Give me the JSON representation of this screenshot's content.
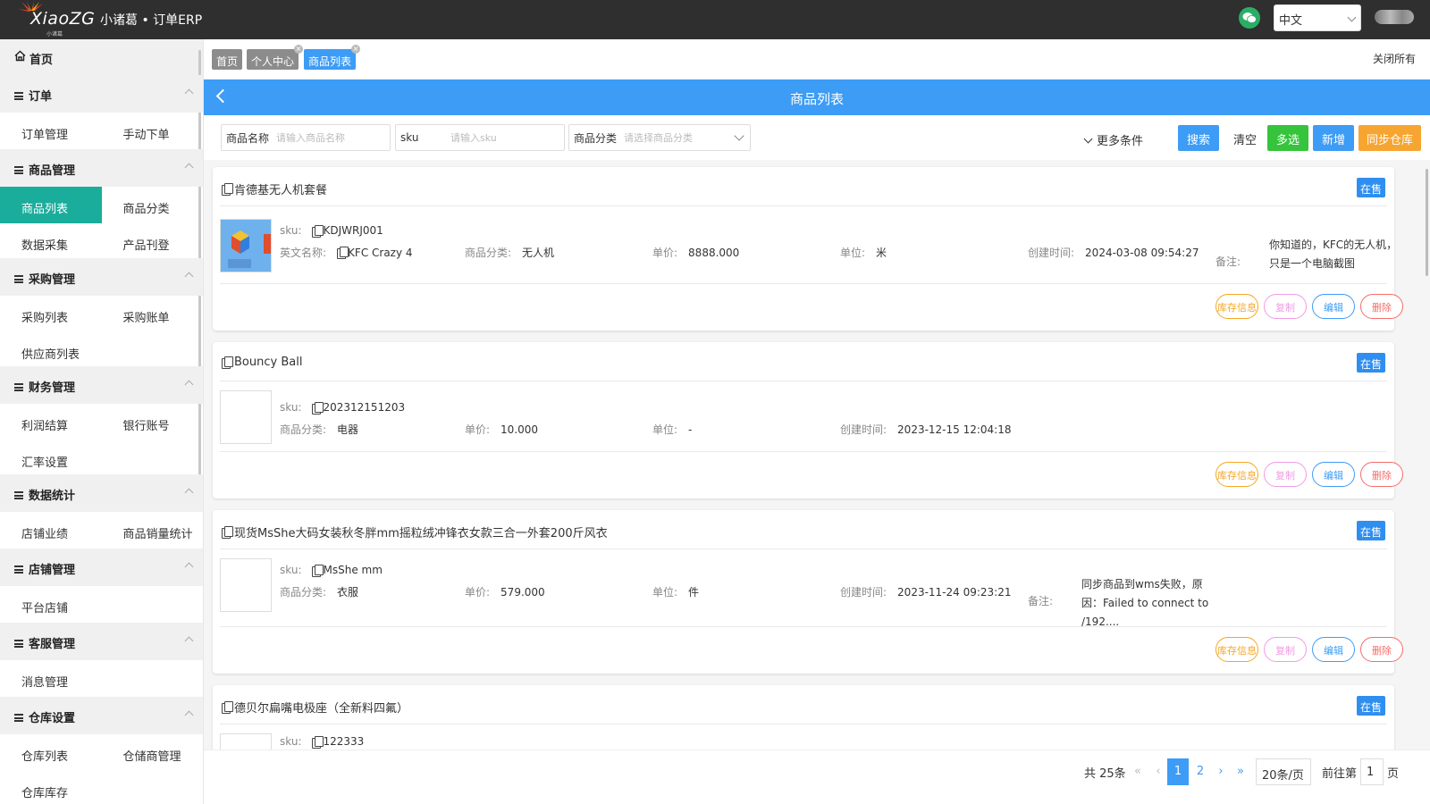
{
  "app": {
    "logo_text": "XiaoZG",
    "logo_sub": "小诸葛",
    "title": "小诸葛 • 订单ERP"
  },
  "topbar": {
    "language": "中文"
  },
  "sidebar": {
    "home": "首页",
    "groups": [
      {
        "label": "订单",
        "items": [
          "订单管理",
          "手动下单"
        ]
      },
      {
        "label": "商品管理",
        "items": [
          "商品列表",
          "商品分类",
          "数据采集",
          "产品刊登"
        ]
      },
      {
        "label": "采购管理",
        "items": [
          "采购列表",
          "采购账单",
          "供应商列表"
        ]
      },
      {
        "label": "财务管理",
        "items": [
          "利润结算",
          "银行账号",
          "汇率设置"
        ]
      },
      {
        "label": "数据统计",
        "items": [
          "店铺业绩",
          "商品销量统计"
        ]
      },
      {
        "label": "店铺管理",
        "items": [
          "平台店铺"
        ]
      },
      {
        "label": "客服管理",
        "items": [
          "消息管理"
        ]
      },
      {
        "label": "仓库设置",
        "items": [
          "仓库列表",
          "仓储商管理",
          "仓库库存"
        ]
      }
    ],
    "active_item": "商品列表"
  },
  "tabs": [
    {
      "label": "首页"
    },
    {
      "label": "个人中心"
    },
    {
      "label": "商品列表"
    }
  ],
  "close_all": "关闭所有",
  "page_title": "商品列表",
  "filters": {
    "name_label": "商品名称",
    "name_placeholder": "请输入商品名称",
    "sku_label": "sku",
    "sku_placeholder": "请输入sku",
    "category_label": "商品分类",
    "category_placeholder": "请选择商品分类",
    "more": "更多条件"
  },
  "buttons": {
    "search": "搜索",
    "clear": "清空",
    "multi": "多选",
    "add": "新增",
    "sync": "同步仓库"
  },
  "labels": {
    "sku": "sku:",
    "en_name": "英文名称:",
    "category": "商品分类:",
    "price": "单价:",
    "unit": "单位:",
    "created": "创建时间:",
    "note": "备注:"
  },
  "products": [
    {
      "name": "肯德基无人机套餐",
      "status": "在售",
      "sku": "KDJWRJ001",
      "en_name": "KFC Crazy 4",
      "category": "无人机",
      "price": "8888.000",
      "unit": "米",
      "created": "2024-03-08 09:54:27",
      "note": "你知道的，KFC的无人机，只是一个电脑截图"
    },
    {
      "name": "Bouncy Ball",
      "status": "在售",
      "sku": "202312151203",
      "category": "电器",
      "price": "10.000",
      "unit": "-",
      "created": "2023-12-15 12:04:18"
    },
    {
      "name": "现货MsShe大码女装秋冬胖mm摇粒绒冲锋衣女款三合一外套200斤风衣",
      "status": "在售",
      "sku": "MsShe mm",
      "category": "衣服",
      "price": "579.000",
      "unit": "件",
      "created": "2023-11-24 09:23:21",
      "note": "同步商品到wms失败，原因：Failed to connect to /192...."
    },
    {
      "name": "德贝尔扁嘴电极座（全新料四氟）",
      "status": "在售",
      "sku": "122333"
    }
  ],
  "actions": {
    "stock": "库存信息",
    "copy": "复制",
    "edit": "编辑",
    "delete": "删除"
  },
  "pagination": {
    "total": "共 25条",
    "pages": [
      "1",
      "2"
    ],
    "current": "1",
    "page_size": "20条/页",
    "goto_label": "前往第",
    "goto_value": "1",
    "page_suffix": "页"
  },
  "colors": {
    "topbar": "#2f2f2f",
    "accent": "#3d9cf5",
    "active_menu": "#1aad9c",
    "green": "#35c43c",
    "orange": "#f7a531"
  }
}
